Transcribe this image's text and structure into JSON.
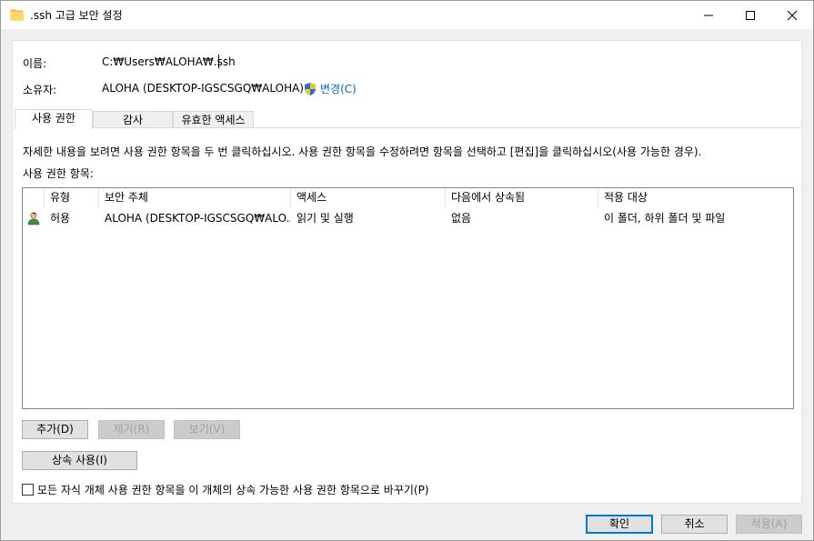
{
  "window": {
    "title": ".ssh 고급 보안 설정"
  },
  "fields": {
    "name_label": "이름:",
    "name_value": "C:₩Users₩ALOHA₩.ssh",
    "owner_label": "소유자:",
    "owner_value": "ALOHA (DESKTOP-IGSCSGQ₩ALOHA)",
    "change_link": "변경(C)"
  },
  "tabs": [
    {
      "label": "사용 권한",
      "active": true
    },
    {
      "label": "감사",
      "active": false
    },
    {
      "label": "유효한 액세스",
      "active": false
    }
  ],
  "instructions": "자세한 내용을 보려면 사용 권한 항목을 두 번 클릭하십시오. 사용 권한 항목을 수정하려면 항목을 선택하고 [편집]을 클릭하십시오(사용 가능한 경우).",
  "list": {
    "label": "사용 권한 항목:",
    "columns": [
      "유형",
      "보안 주체",
      "액세스",
      "다음에서 상속됨",
      "적용 대상"
    ],
    "rows": [
      {
        "icon": "user-icon",
        "type": "허용",
        "principal": "ALOHA (DESKTOP-IGSCSGQ₩ALO...",
        "access": "읽기 및 실행",
        "inherited_from": "없음",
        "applies_to": "이 폴더, 하위 폴더 및 파일"
      }
    ]
  },
  "buttons": {
    "add": "추가(D)",
    "remove": "제거(R)",
    "view": "보기(V)",
    "enable_inheritance": "상속 사용(I)",
    "ok": "확인",
    "cancel": "취소",
    "apply": "적용(A)"
  },
  "replace_checkbox": {
    "label": "모든 자식 개체 사용 권한 항목을 이 개체의 상속 가능한 사용 권한 항목으로 바꾸기(P)",
    "checked": false
  },
  "colors": {
    "link": "#0066cc",
    "accent": "#0078d7",
    "window_bg": "#f0f0f0"
  }
}
